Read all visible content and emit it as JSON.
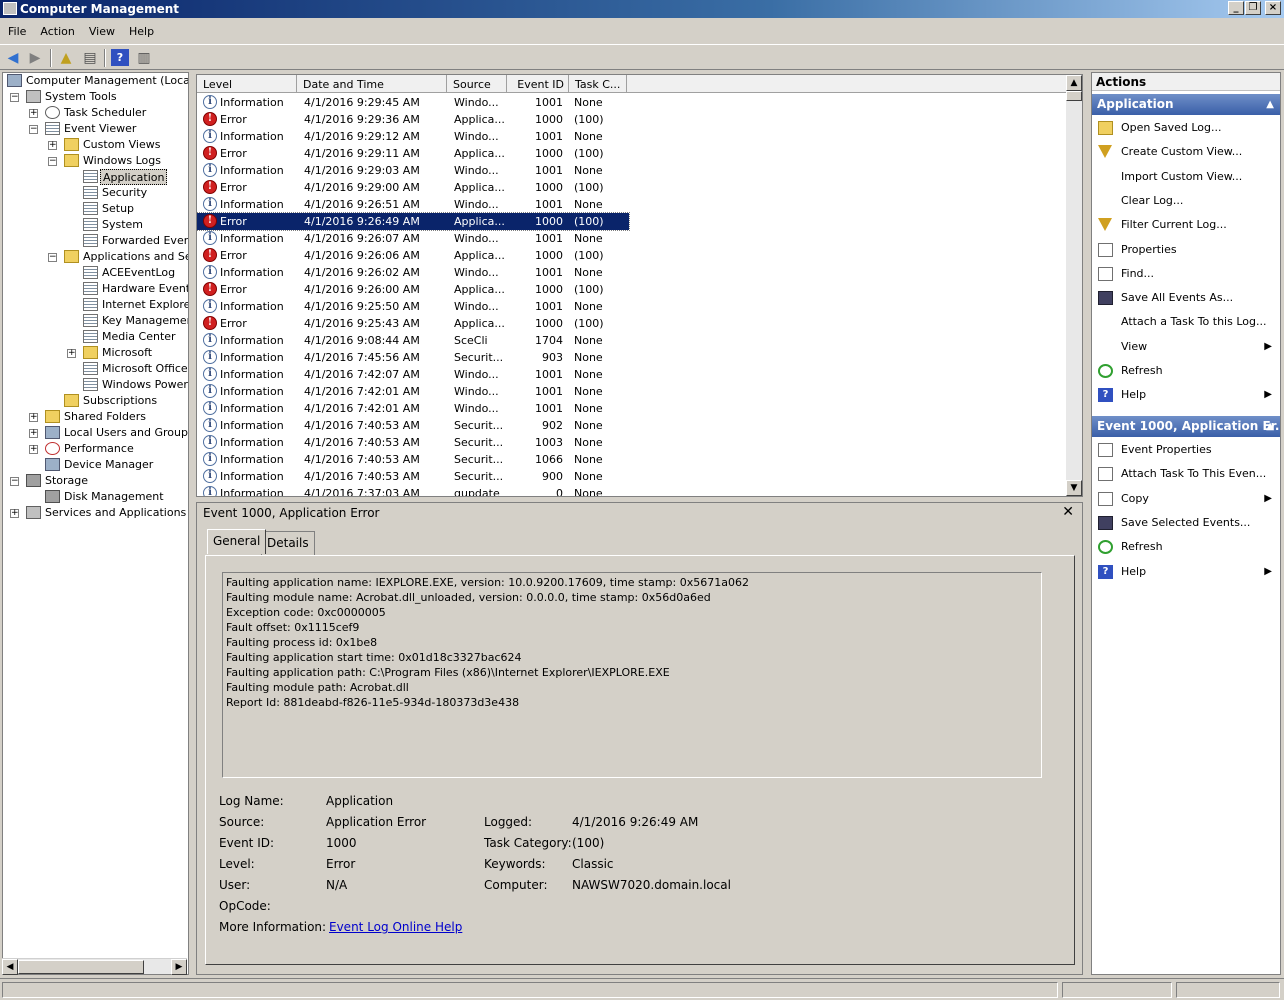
{
  "window": {
    "title": "Computer Management"
  },
  "menu": [
    "File",
    "Action",
    "View",
    "Help"
  ],
  "tree": {
    "root": "Computer Management (Local)",
    "system_tools": "System Tools",
    "task_scheduler": "Task Scheduler",
    "event_viewer": "Event Viewer",
    "custom_views": "Custom Views",
    "windows_logs": "Windows Logs",
    "application": "Application",
    "security": "Security",
    "setup": "Setup",
    "system": "System",
    "forwarded": "Forwarded Events",
    "apps_services": "Applications and Servi",
    "ace": "ACEEventLog",
    "hardware": "Hardware Events",
    "ie": "Internet Explorer",
    "keymgmt": "Key Management",
    "media": "Media Center",
    "microsoft": "Microsoft",
    "msoffice": "Microsoft Office A",
    "powershell": "Windows PowerSh",
    "subscriptions": "Subscriptions",
    "shared": "Shared Folders",
    "localusers": "Local Users and Groups",
    "performance": "Performance",
    "devmgr": "Device Manager",
    "storage": "Storage",
    "diskmgmt": "Disk Management",
    "services": "Services and Applications"
  },
  "columns": [
    "Level",
    "Date and Time",
    "Source",
    "Event ID",
    "Task C..."
  ],
  "events": [
    {
      "level": "Information",
      "type": "info",
      "date": "4/1/2016 9:29:45 AM",
      "source": "Windo...",
      "id": "1001",
      "task": "None"
    },
    {
      "level": "Error",
      "type": "err",
      "date": "4/1/2016 9:29:36 AM",
      "source": "Applica...",
      "id": "1000",
      "task": "(100)"
    },
    {
      "level": "Information",
      "type": "info",
      "date": "4/1/2016 9:29:12 AM",
      "source": "Windo...",
      "id": "1001",
      "task": "None"
    },
    {
      "level": "Error",
      "type": "err",
      "date": "4/1/2016 9:29:11 AM",
      "source": "Applica...",
      "id": "1000",
      "task": "(100)"
    },
    {
      "level": "Information",
      "type": "info",
      "date": "4/1/2016 9:29:03 AM",
      "source": "Windo...",
      "id": "1001",
      "task": "None"
    },
    {
      "level": "Error",
      "type": "err",
      "date": "4/1/2016 9:29:00 AM",
      "source": "Applica...",
      "id": "1000",
      "task": "(100)"
    },
    {
      "level": "Information",
      "type": "info",
      "date": "4/1/2016 9:26:51 AM",
      "source": "Windo...",
      "id": "1001",
      "task": "None"
    },
    {
      "level": "Error",
      "type": "err",
      "date": "4/1/2016 9:26:49 AM",
      "source": "Applica...",
      "id": "1000",
      "task": "(100)",
      "selected": true
    },
    {
      "level": "Information",
      "type": "info",
      "date": "4/1/2016 9:26:07 AM",
      "source": "Windo...",
      "id": "1001",
      "task": "None"
    },
    {
      "level": "Error",
      "type": "err",
      "date": "4/1/2016 9:26:06 AM",
      "source": "Applica...",
      "id": "1000",
      "task": "(100)"
    },
    {
      "level": "Information",
      "type": "info",
      "date": "4/1/2016 9:26:02 AM",
      "source": "Windo...",
      "id": "1001",
      "task": "None"
    },
    {
      "level": "Error",
      "type": "err",
      "date": "4/1/2016 9:26:00 AM",
      "source": "Applica...",
      "id": "1000",
      "task": "(100)"
    },
    {
      "level": "Information",
      "type": "info",
      "date": "4/1/2016 9:25:50 AM",
      "source": "Windo...",
      "id": "1001",
      "task": "None"
    },
    {
      "level": "Error",
      "type": "err",
      "date": "4/1/2016 9:25:43 AM",
      "source": "Applica...",
      "id": "1000",
      "task": "(100)"
    },
    {
      "level": "Information",
      "type": "info",
      "date": "4/1/2016 9:08:44 AM",
      "source": "SceCli",
      "id": "1704",
      "task": "None"
    },
    {
      "level": "Information",
      "type": "info",
      "date": "4/1/2016 7:45:56 AM",
      "source": "Securit...",
      "id": "903",
      "task": "None"
    },
    {
      "level": "Information",
      "type": "info",
      "date": "4/1/2016 7:42:07 AM",
      "source": "Windo...",
      "id": "1001",
      "task": "None"
    },
    {
      "level": "Information",
      "type": "info",
      "date": "4/1/2016 7:42:01 AM",
      "source": "Windo...",
      "id": "1001",
      "task": "None"
    },
    {
      "level": "Information",
      "type": "info",
      "date": "4/1/2016 7:42:01 AM",
      "source": "Windo...",
      "id": "1001",
      "task": "None"
    },
    {
      "level": "Information",
      "type": "info",
      "date": "4/1/2016 7:40:53 AM",
      "source": "Securit...",
      "id": "902",
      "task": "None"
    },
    {
      "level": "Information",
      "type": "info",
      "date": "4/1/2016 7:40:53 AM",
      "source": "Securit...",
      "id": "1003",
      "task": "None"
    },
    {
      "level": "Information",
      "type": "info",
      "date": "4/1/2016 7:40:53 AM",
      "source": "Securit...",
      "id": "1066",
      "task": "None"
    },
    {
      "level": "Information",
      "type": "info",
      "date": "4/1/2016 7:40:53 AM",
      "source": "Securit...",
      "id": "900",
      "task": "None"
    },
    {
      "level": "Information",
      "type": "info",
      "date": "4/1/2016 7:37:03 AM",
      "source": "gupdate",
      "id": "0",
      "task": "None"
    }
  ],
  "detail": {
    "title": "Event 1000, Application Error",
    "tabs": [
      "General",
      "Details"
    ],
    "message": [
      "Faulting application name: IEXPLORE.EXE, version: 10.0.9200.17609, time stamp: 0x5671a062",
      "Faulting module name: Acrobat.dll_unloaded, version: 0.0.0.0, time stamp: 0x56d0a6ed",
      "Exception code: 0xc0000005",
      "Fault offset: 0x1115cef9",
      "Faulting process id: 0x1be8",
      "Faulting application start time: 0x01d18c3327bac624",
      "Faulting application path: C:\\Program Files (x86)\\Internet Explorer\\IEXPLORE.EXE",
      "Faulting module path: Acrobat.dll",
      "Report Id: 881deabd-f826-11e5-934d-180373d3e438"
    ],
    "labels": {
      "log_name": "Log Name:",
      "source": "Source:",
      "event_id": "Event ID:",
      "level": "Level:",
      "user": "User:",
      "opcode": "OpCode:",
      "more_info": "More Information:",
      "logged": "Logged:",
      "task_category": "Task Category:",
      "keywords": "Keywords:",
      "computer": "Computer:"
    },
    "values": {
      "log_name": "Application",
      "source": "Application Error",
      "event_id": "1000",
      "level": "Error",
      "user": "N/A",
      "opcode": "",
      "more_info_link": "Event Log Online Help",
      "logged": "4/1/2016 9:26:49 AM",
      "task_category": "(100)",
      "keywords": "Classic",
      "computer": "NAWSW7020.domain.local"
    }
  },
  "actions": {
    "header": "Actions",
    "section1": "Application",
    "items1": [
      {
        "label": "Open Saved Log...",
        "icon": "folder-open-icon"
      },
      {
        "label": "Create Custom View...",
        "icon": "filter-icon"
      },
      {
        "label": "Import Custom View...",
        "icon": ""
      },
      {
        "label": "Clear Log...",
        "icon": ""
      },
      {
        "label": "Filter Current Log...",
        "icon": "filter-icon"
      },
      {
        "label": "Properties",
        "icon": "properties-icon"
      },
      {
        "label": "Find...",
        "icon": "binoculars-icon"
      },
      {
        "label": "Save All Events As...",
        "icon": "floppy-icon"
      },
      {
        "label": "Attach a Task To this Log...",
        "icon": ""
      },
      {
        "label": "View",
        "icon": "",
        "submenu": true
      },
      {
        "label": "Refresh",
        "icon": "refresh-icon"
      },
      {
        "label": "Help",
        "icon": "help-icon",
        "submenu": true
      }
    ],
    "section2": "Event 1000, Application Er...",
    "items2": [
      {
        "label": "Event Properties",
        "icon": "properties-icon"
      },
      {
        "label": "Attach Task To This Even...",
        "icon": "task-icon"
      },
      {
        "label": "Copy",
        "icon": "copy-icon",
        "submenu": true
      },
      {
        "label": "Save Selected Events...",
        "icon": "floppy-icon"
      },
      {
        "label": "Refresh",
        "icon": "refresh-icon"
      },
      {
        "label": "Help",
        "icon": "help-icon",
        "submenu": true
      }
    ]
  }
}
